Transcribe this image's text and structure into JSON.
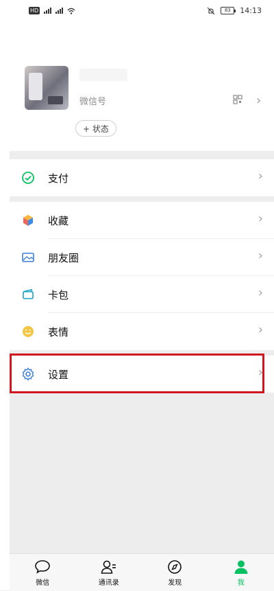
{
  "status_bar": {
    "left": "HD 4G 4G",
    "time": "14:13",
    "battery": "83"
  },
  "profile": {
    "wechat_id_label": "微信号",
    "status_button": "+ 状态"
  },
  "groups": [
    {
      "items": [
        {
          "label": "支付",
          "icon": "pay-check-icon"
        }
      ]
    },
    {
      "items": [
        {
          "label": "收藏",
          "icon": "favorites-cube-icon"
        },
        {
          "label": "朋友圈",
          "icon": "moments-picture-icon"
        },
        {
          "label": "卡包",
          "icon": "card-wallet-icon"
        },
        {
          "label": "表情",
          "icon": "emoji-smile-icon"
        }
      ]
    },
    {
      "items": [
        {
          "label": "设置",
          "icon": "settings-gear-icon"
        }
      ]
    }
  ],
  "tabbar": {
    "tabs": [
      {
        "label": "微信",
        "icon": "chat-bubble-icon"
      },
      {
        "label": "通讯录",
        "icon": "contacts-icon"
      },
      {
        "label": "发现",
        "icon": "compass-icon"
      },
      {
        "label": "我",
        "icon": "person-icon",
        "active": true
      }
    ]
  },
  "colors": {
    "accent": "#07c160",
    "highlight": "#d2161e"
  }
}
